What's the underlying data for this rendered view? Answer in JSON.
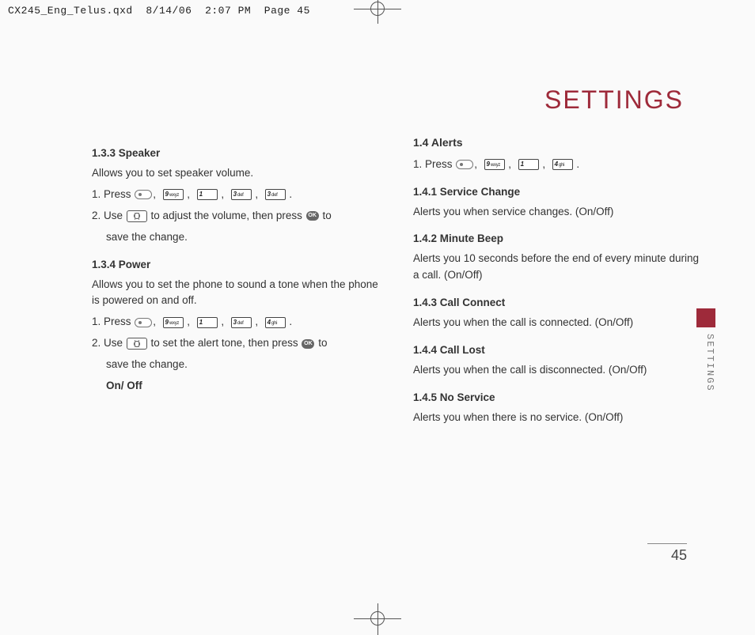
{
  "header": {
    "filename": "CX245_Eng_Telus.qxd",
    "date": "8/14/06",
    "time": "2:07 PM",
    "pagelabel": "Page 45"
  },
  "title": "SETTINGS",
  "side_label": "SETTINGS",
  "page_number": "45",
  "left": {
    "s133_title": "1.3.3 Speaker",
    "s133_intro": "Allows you to set speaker volume.",
    "s133_step1_pre": "1. Press ",
    "s133_step2_pre": "2. Use ",
    "s133_step2_mid": " to adjust the volume, then press ",
    "s133_step2_post": " to",
    "s133_step2_line2": "save the change.",
    "s134_title": "1.3.4 Power",
    "s134_intro": "Allows you to set the phone to sound a tone when the phone is powered on and off.",
    "s134_step1_pre": "1. Press ",
    "s134_step2_pre": "2. Use ",
    "s134_step2_mid": " to set the alert tone, then press ",
    "s134_step2_post": " to",
    "s134_step2_line2": "save the change.",
    "s134_onoff": "On/ Off"
  },
  "right": {
    "s14_title": "1.4 Alerts",
    "s14_step1_pre": "1. Press ",
    "s141_title": "1.4.1 Service Change",
    "s141_body": "Alerts you when service changes. (On/Off)",
    "s142_title": "1.4.2 Minute Beep",
    "s142_body": "Alerts you 10 seconds before the end of every minute during a call. (On/Off)",
    "s143_title": "1.4.3 Call Connect",
    "s143_body": "Alerts you when the call is connected. (On/Off)",
    "s144_title": "1.4.4 Call Lost",
    "s144_body": "Alerts you when the call is disconnected. (On/Off)",
    "s145_title": "1.4.5 No Service",
    "s145_body": "Alerts you when there is no service. (On/Off)"
  },
  "keys": {
    "k1": "1",
    "k3": "3",
    "k4": "4",
    "k9": "9",
    "sub1": "",
    "sub3": "def",
    "sub4": "ghi",
    "sub9": "wxyz",
    "ok": "OK"
  }
}
